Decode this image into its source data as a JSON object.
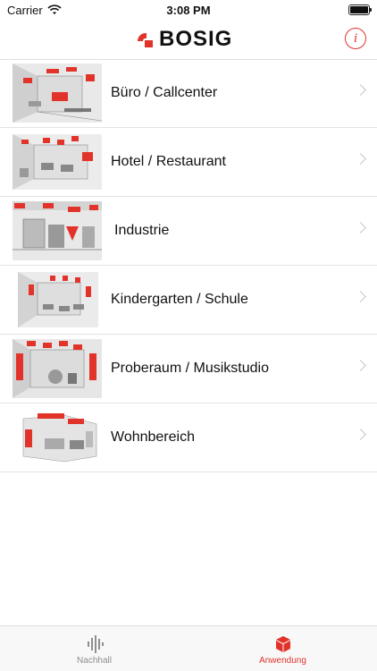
{
  "status_bar": {
    "carrier": "Carrier",
    "time": "3:08 PM"
  },
  "header": {
    "brand": "BOSIG",
    "info_icon": "info-icon",
    "accent": "#e2332a"
  },
  "list": {
    "items": [
      {
        "label": "Büro / Callcenter",
        "icon": "office-illustration"
      },
      {
        "label": "Hotel / Restaurant",
        "icon": "restaurant-illustration"
      },
      {
        "label": "Industrie",
        "icon": "industry-illustration"
      },
      {
        "label": "Kindergarten / Schule",
        "icon": "classroom-illustration"
      },
      {
        "label": "Proberaum / Musikstudio",
        "icon": "studio-illustration"
      },
      {
        "label": "Wohnbereich",
        "icon": "living-illustration"
      }
    ]
  },
  "tabbar": {
    "tabs": [
      {
        "label": "Nachhall",
        "icon": "waveform-icon",
        "active": false
      },
      {
        "label": "Anwendung",
        "icon": "cube-icon",
        "active": true
      }
    ]
  }
}
